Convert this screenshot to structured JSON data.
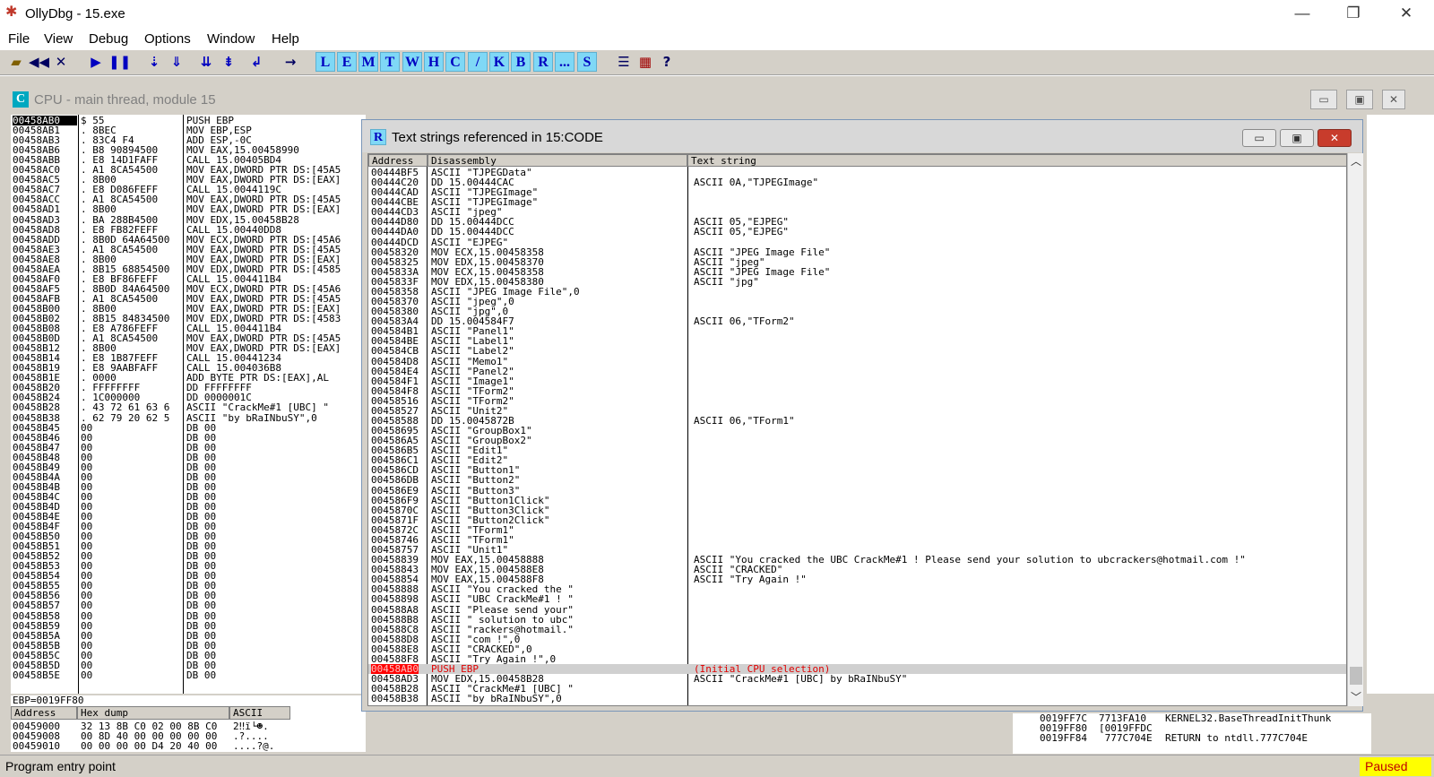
{
  "window": {
    "title": "OllyDbg - 15.exe",
    "minimize": "—",
    "maximize": "❐",
    "close": "✕"
  },
  "menu": [
    "File",
    "View",
    "Debug",
    "Options",
    "Window",
    "Help"
  ],
  "toolbar": {
    "icons": [
      "open-icon",
      "rewind-icon",
      "close-icon",
      "run-icon",
      "pause-icon",
      "step-into-icon",
      "step-over-icon",
      "trace-into-icon",
      "trace-over-icon",
      "execute-till-return-icon",
      "goto-icon"
    ],
    "letters": [
      "L",
      "E",
      "M",
      "T",
      "W",
      "H",
      "C",
      "/",
      "K",
      "B",
      "R",
      "...",
      "S"
    ],
    "trailing": [
      "list-icon",
      "grid-icon",
      "help-icon"
    ],
    "help": "?"
  },
  "cpu": {
    "icon": "C",
    "title": "CPU - main thread, module 15",
    "rows": [
      [
        "00458AB0",
        "$ 55",
        "PUSH EBP"
      ],
      [
        "00458AB1",
        ". 8BEC",
        "MOV EBP,ESP"
      ],
      [
        "00458AB3",
        ". 83C4 F4",
        "ADD ESP,-0C"
      ],
      [
        "00458AB6",
        ". B8 90894500",
        "MOV EAX,15.00458990"
      ],
      [
        "00458ABB",
        ". E8 14D1FAFF",
        "CALL 15.00405BD4"
      ],
      [
        "00458AC0",
        ". A1 8CA54500",
        "MOV EAX,DWORD PTR DS:[45A5"
      ],
      [
        "00458AC5",
        ". 8B00",
        "MOV EAX,DWORD PTR DS:[EAX]"
      ],
      [
        "00458AC7",
        ". E8 D086FEFF",
        "CALL 15.0044119C"
      ],
      [
        "00458ACC",
        ". A1 8CA54500",
        "MOV EAX,DWORD PTR DS:[45A5"
      ],
      [
        "00458AD1",
        ". 8B00",
        "MOV EAX,DWORD PTR DS:[EAX]"
      ],
      [
        "00458AD3",
        ". BA 288B4500",
        "MOV EDX,15.00458B28"
      ],
      [
        "00458AD8",
        ". E8 FB82FEFF",
        "CALL 15.00440DD8"
      ],
      [
        "00458ADD",
        ". 8B0D 64A64500",
        "MOV ECX,DWORD PTR DS:[45A6"
      ],
      [
        "00458AE3",
        ". A1 8CA54500",
        "MOV EAX,DWORD PTR DS:[45A5"
      ],
      [
        "00458AE8",
        ". 8B00",
        "MOV EAX,DWORD PTR DS:[EAX]"
      ],
      [
        "00458AEA",
        ". 8B15 68854500",
        "MOV EDX,DWORD PTR DS:[4585"
      ],
      [
        "00458AF0",
        ". E8 BF86FEFF",
        "CALL 15.004411B4"
      ],
      [
        "00458AF5",
        ". 8B0D 84A64500",
        "MOV ECX,DWORD PTR DS:[45A6"
      ],
      [
        "00458AFB",
        ". A1 8CA54500",
        "MOV EAX,DWORD PTR DS:[45A5"
      ],
      [
        "00458B00",
        ". 8B00",
        "MOV EAX,DWORD PTR DS:[EAX]"
      ],
      [
        "00458B02",
        ". 8B15 84834500",
        "MOV EDX,DWORD PTR DS:[4583"
      ],
      [
        "00458B08",
        ". E8 A786FEFF",
        "CALL 15.004411B4"
      ],
      [
        "00458B0D",
        ". A1 8CA54500",
        "MOV EAX,DWORD PTR DS:[45A5"
      ],
      [
        "00458B12",
        ". 8B00",
        "MOV EAX,DWORD PTR DS:[EAX]"
      ],
      [
        "00458B14",
        ". E8 1B87FEFF",
        "CALL 15.00441234"
      ],
      [
        "00458B19",
        ". E8 9AABFAFF",
        "CALL 15.004036B8"
      ],
      [
        "00458B1E",
        ". 0000",
        "ADD BYTE PTR DS:[EAX],AL"
      ],
      [
        "00458B20",
        ". FFFFFFFF",
        "DD FFFFFFFF"
      ],
      [
        "00458B24",
        ". 1C000000",
        "DD 0000001C"
      ],
      [
        "00458B28",
        ". 43 72 61 63 6",
        "ASCII \"CrackMe#1 [UBC] \""
      ],
      [
        "00458B38",
        ". 62 79 20 62 5",
        "ASCII \"by bRaINbuSY\",0"
      ],
      [
        "00458B45",
        "00",
        "DB 00"
      ],
      [
        "00458B46",
        "00",
        "DB 00"
      ],
      [
        "00458B47",
        "00",
        "DB 00"
      ],
      [
        "00458B48",
        "00",
        "DB 00"
      ],
      [
        "00458B49",
        "00",
        "DB 00"
      ],
      [
        "00458B4A",
        "00",
        "DB 00"
      ],
      [
        "00458B4B",
        "00",
        "DB 00"
      ],
      [
        "00458B4C",
        "00",
        "DB 00"
      ],
      [
        "00458B4D",
        "00",
        "DB 00"
      ],
      [
        "00458B4E",
        "00",
        "DB 00"
      ],
      [
        "00458B4F",
        "00",
        "DB 00"
      ],
      [
        "00458B50",
        "00",
        "DB 00"
      ],
      [
        "00458B51",
        "00",
        "DB 00"
      ],
      [
        "00458B52",
        "00",
        "DB 00"
      ],
      [
        "00458B53",
        "00",
        "DB 00"
      ],
      [
        "00458B54",
        "00",
        "DB 00"
      ],
      [
        "00458B55",
        "00",
        "DB 00"
      ],
      [
        "00458B56",
        "00",
        "DB 00"
      ],
      [
        "00458B57",
        "00",
        "DB 00"
      ],
      [
        "00458B58",
        "00",
        "DB 00"
      ],
      [
        "00458B59",
        "00",
        "DB 00"
      ],
      [
        "00458B5A",
        "00",
        "DB 00"
      ],
      [
        "00458B5B",
        "00",
        "DB 00"
      ],
      [
        "00458B5C",
        "00",
        "DB 00"
      ],
      [
        "00458B5D",
        "00",
        "DB 00"
      ],
      [
        "00458B5E",
        "00",
        "DB 00"
      ]
    ],
    "ebp_line": "EBP=0019FF80"
  },
  "dump": {
    "headers": [
      "Address",
      "Hex dump",
      "ASCII"
    ],
    "rows": [
      [
        "00459000",
        "32 13 8B C0 02 00 8B C0",
        "2‼ï└☻."
      ],
      [
        "00459008",
        "00 8D 40 00 00 00 00 00",
        ".?...."
      ],
      [
        "00459010",
        "00 00 00 00 D4 20 40 00",
        "....?@."
      ]
    ]
  },
  "stack": {
    "rows": [
      [
        "0019FF7C",
        "7713FA10",
        "KERNEL32.BaseThreadInitThunk"
      ],
      [
        "0019FF80",
        "[0019FFDC",
        ""
      ],
      [
        "0019FF84",
        " 777C704E",
        "RETURN to ntdll.777C704E"
      ]
    ]
  },
  "dialog": {
    "icon": "R",
    "title": "Text strings referenced in 15:CODE",
    "headers": [
      "Address",
      "Disassembly",
      "Text string"
    ],
    "rows": [
      [
        "00444BF5",
        "ASCII \"TJPEGData\"",
        ""
      ],
      [
        "00444C20",
        "DD 15.00444CAC",
        "ASCII 0A,\"TJPEGImage\""
      ],
      [
        "00444CAD",
        "ASCII \"TJPEGImage\"",
        ""
      ],
      [
        "00444CBE",
        "ASCII \"TJPEGImage\"",
        ""
      ],
      [
        "00444CD3",
        "ASCII \"jpeg\"",
        ""
      ],
      [
        "00444D80",
        "DD 15.00444DCC",
        "ASCII 05,\"EJPEG\""
      ],
      [
        "00444DA0",
        "DD 15.00444DCC",
        "ASCII 05,\"EJPEG\""
      ],
      [
        "00444DCD",
        "ASCII \"EJPEG\"",
        ""
      ],
      [
        "00458320",
        "MOV ECX,15.00458358",
        "ASCII \"JPEG Image File\""
      ],
      [
        "00458325",
        "MOV EDX,15.00458370",
        "ASCII \"jpeg\""
      ],
      [
        "0045833A",
        "MOV ECX,15.00458358",
        "ASCII \"JPEG Image File\""
      ],
      [
        "0045833F",
        "MOV EDX,15.00458380",
        "ASCII \"jpg\""
      ],
      [
        "00458358",
        "ASCII \"JPEG Image File\",0",
        ""
      ],
      [
        "00458370",
        "ASCII \"jpeg\",0",
        ""
      ],
      [
        "00458380",
        "ASCII \"jpg\",0",
        ""
      ],
      [
        "004583A4",
        "DD 15.004584F7",
        "ASCII 06,\"TForm2\""
      ],
      [
        "004584B1",
        "ASCII \"Panel1\"",
        ""
      ],
      [
        "004584BE",
        "ASCII \"Label1\"",
        ""
      ],
      [
        "004584CB",
        "ASCII \"Label2\"",
        ""
      ],
      [
        "004584D8",
        "ASCII \"Memo1\"",
        ""
      ],
      [
        "004584E4",
        "ASCII \"Panel2\"",
        ""
      ],
      [
        "004584F1",
        "ASCII \"Image1\"",
        ""
      ],
      [
        "004584F8",
        "ASCII \"TForm2\"",
        ""
      ],
      [
        "00458516",
        "ASCII \"TForm2\"",
        ""
      ],
      [
        "00458527",
        "ASCII \"Unit2\"",
        ""
      ],
      [
        "00458588",
        "DD 15.0045872B",
        "ASCII 06,\"TForm1\""
      ],
      [
        "00458695",
        "ASCII \"GroupBox1\"",
        ""
      ],
      [
        "004586A5",
        "ASCII \"GroupBox2\"",
        ""
      ],
      [
        "004586B5",
        "ASCII \"Edit1\"",
        ""
      ],
      [
        "004586C1",
        "ASCII \"Edit2\"",
        ""
      ],
      [
        "004586CD",
        "ASCII \"Button1\"",
        ""
      ],
      [
        "004586DB",
        "ASCII \"Button2\"",
        ""
      ],
      [
        "004586E9",
        "ASCII \"Button3\"",
        ""
      ],
      [
        "004586F9",
        "ASCII \"Button1Click\"",
        ""
      ],
      [
        "0045870C",
        "ASCII \"Button3Click\"",
        ""
      ],
      [
        "0045871F",
        "ASCII \"Button2Click\"",
        ""
      ],
      [
        "0045872C",
        "ASCII \"TForm1\"",
        ""
      ],
      [
        "00458746",
        "ASCII \"TForm1\"",
        ""
      ],
      [
        "00458757",
        "ASCII \"Unit1\"",
        ""
      ],
      [
        "00458839",
        "MOV EAX,15.00458888",
        "ASCII \"You cracked the UBC CrackMe#1 ! Please send your solution to ubcrackers@hotmail.com !\""
      ],
      [
        "00458843",
        "MOV EAX,15.004588E8",
        "ASCII \"CRACKED\""
      ],
      [
        "00458854",
        "MOV EAX,15.004588F8",
        "ASCII \"Try Again !\""
      ],
      [
        "00458888",
        "ASCII \"You cracked the \"",
        ""
      ],
      [
        "00458898",
        "ASCII \"UBC CrackMe#1 ! \"",
        ""
      ],
      [
        "004588A8",
        "ASCII \"Please send your\"",
        ""
      ],
      [
        "004588B8",
        "ASCII \" solution to ubc\"",
        ""
      ],
      [
        "004588C8",
        "ASCII \"rackers@hotmail.\"",
        ""
      ],
      [
        "004588D8",
        "ASCII \"com !\",0",
        ""
      ],
      [
        "004588E8",
        "ASCII \"CRACKED\",0",
        ""
      ],
      [
        "004588F8",
        "ASCII \"Try Again !\",0",
        ""
      ],
      [
        "00458AB0",
        "PUSH EBP",
        "(Initial CPU selection)"
      ],
      [
        "00458AD3",
        "MOV EDX,15.00458B28",
        "ASCII \"CrackMe#1 [UBC] by bRaINbuSY\""
      ],
      [
        "00458B28",
        "ASCII \"CrackMe#1 [UBC] \"",
        ""
      ],
      [
        "00458B38",
        "ASCII \"by bRaINbuSY\",0",
        ""
      ]
    ],
    "highlighted_row": 50,
    "minimize": "▭",
    "maximize": "▣",
    "close": "✕"
  },
  "statusbar": {
    "text": "Program entry point",
    "state": "Paused"
  }
}
